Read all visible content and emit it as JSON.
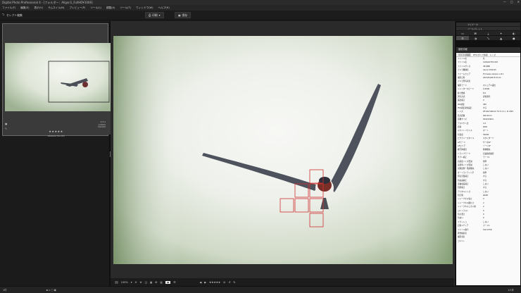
{
  "window": {
    "title": "Digital Photo Professional 4 - [フォルダー：Aligon1_FullHD¥1006]",
    "controls": [
      "—",
      "□",
      "✕"
    ]
  },
  "menu": [
    "ファイル(F)",
    "編集(E)",
    "表示(V)",
    "サムネイル(N)",
    "プレビュー(P)",
    "ツール(L)",
    "調整(A)",
    "ツール(T)",
    "ウィンドウ(W)",
    "ヘルプ(H)"
  ],
  "toolbar": {
    "back_label": "セレクト編集",
    "print_label": "印刷",
    "save_label": "保存"
  },
  "thumbnail": {
    "meta_lines": [
      "1/3.2",
      "1/2000",
      "ISO400"
    ],
    "stars": "★★★★★",
    "filename": "1006A0758.CR3"
  },
  "right_panel": {
    "tabs": [
      "ナビゲータ",
      "ツールパレット"
    ],
    "icons": [
      "▭",
      "⌘",
      "⤓",
      "✦",
      "◐",
      "⚙",
      "◑",
      "⤡",
      "▲",
      "●"
    ],
    "info_title": "撮影情報",
    "subtabs": [
      "ファイル情報",
      "IPTC/ボイス情報",
      "レンズ"
    ],
    "rows": [
      [
        "ファイル名",
        "有"
      ],
      [
        "ファイル名",
        "1006A0758.CR3"
      ],
      [
        "ファイルサイズ",
        "38.8MB"
      ],
      [
        "カメラ機種名",
        "Canon EOS R5"
      ],
      [
        "ファームウェア",
        "Firmware Version 1.8.1"
      ],
      [
        "撮影日時",
        "2023/04/28 8:44:11"
      ],
      [
        "カメラ所有者名",
        ""
      ],
      [
        "撮影モード",
        "マニュアル露出"
      ],
      [
        "シャッタースピード",
        "1/2000"
      ],
      [
        "絞り数値",
        "8.0"
      ],
      [
        "測光方式",
        "評価測光"
      ],
      [
        "露出補正",
        "0"
      ],
      [
        "ISO感度",
        "400"
      ],
      [
        "ISO感度自動設定",
        "する"
      ],
      [
        "レンズ",
        "RF100-500mm F4.5-7.1 L IS USM"
      ],
      [
        "焦点距離",
        "500.0mm"
      ],
      [
        "画像サイズ",
        "8192x5464"
      ],
      [
        "アスペクト比",
        "3:2"
      ],
      [
        "画質",
        "RAW"
      ],
      [
        "ホワイトバランス",
        "オート"
      ],
      [
        "色温度",
        "5200K"
      ],
      [
        "ピクチャースタイル",
        "スタンダード"
      ],
      [
        "AFモード",
        "サーボAF"
      ],
      [
        "AFエリア",
        "ゾーンAF"
      ],
      [
        "被写体検出",
        "動物優先"
      ],
      [
        "ドライブモード",
        "高速連続撮影"
      ],
      [
        "手ブレ補正",
        "モード1"
      ],
      [
        "高感度ノイズ低減",
        "標準"
      ],
      [
        "長秒時ノイズ低減",
        "しない"
      ],
      [
        "高輝度側・階調優先",
        "しない"
      ],
      [
        "オートライティング",
        "標準"
      ],
      [
        "周辺光量補正",
        "する"
      ],
      [
        "色収差補正",
        "する"
      ],
      [
        "歪曲収差補正",
        "しない"
      ],
      [
        "回折補正",
        "する"
      ],
      [
        "デジタルレンズ",
        "しない"
      ],
      [
        "色空間",
        "sRGB"
      ],
      [
        "シャープネス強さ",
        "4"
      ],
      [
        "シャープネス細かさ",
        "2"
      ],
      [
        "シャープネスしきい値",
        "2"
      ],
      [
        "コントラスト",
        "0"
      ],
      [
        "色の濃さ",
        "0"
      ],
      [
        "色あい",
        "0"
      ],
      [
        "フラッシュ",
        "しない"
      ],
      [
        "記録メディア",
        "カード1"
      ],
      [
        "ファイル番号",
        "100-0758"
      ],
      [
        "著作権者名",
        ""
      ],
      [
        "撮影者名",
        ""
      ],
      [
        "コメント",
        ""
      ]
    ]
  },
  "viewer_bottom": {
    "zoom": "100%",
    "stars": "★★★★★"
  },
  "status": {
    "left": "1件",
    "right": "1/1件"
  },
  "colors": {
    "af_frame": "#d03030",
    "panel_bg": "#1b1b1b"
  }
}
